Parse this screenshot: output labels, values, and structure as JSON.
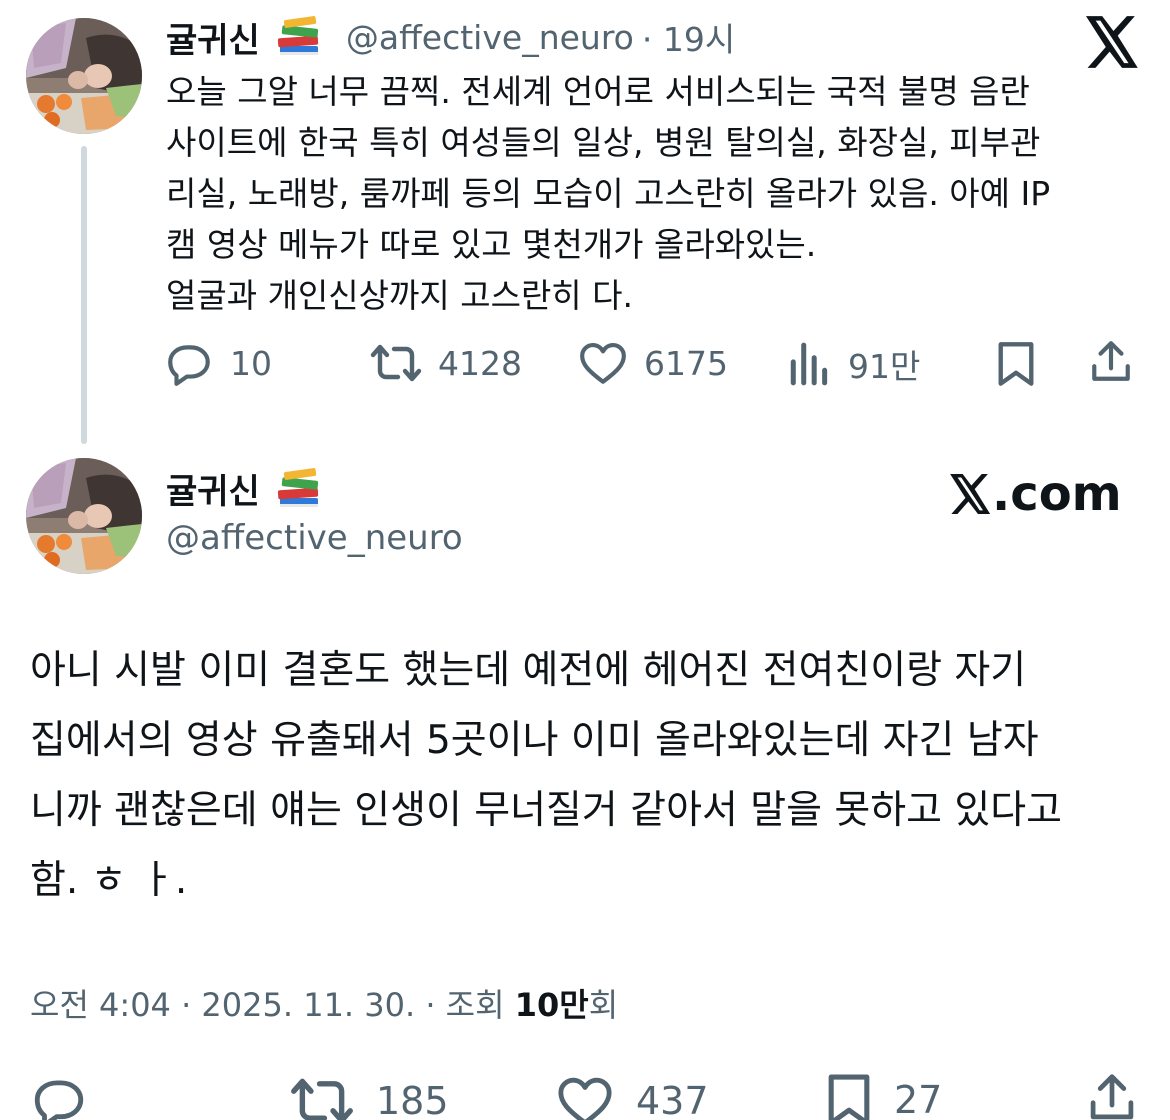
{
  "tweet1": {
    "display_name": "귤귀신",
    "handle": "@affective_neuro",
    "time": "· 19시",
    "body_lines": [
      "오늘 그알 너무 끔찍. 전세계 언어로 서비스되는 국적 불명 음란",
      "사이트에 한국 특히 여성들의 일상, 병원 탈의실, 화장실, 피부관",
      "리실, 노래방, 룸까페 등의 모습이 고스란히 올라가 있음. 아예 IP",
      "캠 영상 메뉴가 따로 있고 몇천개가 올라와있는.",
      "얼굴과 개인신상까지 고스란히 다."
    ],
    "replies": "10",
    "reposts": "4128",
    "likes": "6175",
    "views": "91만"
  },
  "tweet2": {
    "display_name": "귤귀신",
    "handle": "@affective_neuro",
    "brand": ".com",
    "body_lines": [
      "아니 시발 이미 결혼도 했는데 예전에 헤어진 전여친이랑 자기",
      "집에서의 영상 유출돼서 5곳이나 이미 올라와있는데 자긴 남자",
      "니까 괜찮은데 얘는 인생이 무너질거 같아서 말을 못하고 있다고",
      "함. ㅎ ㅏ."
    ],
    "meta_prefix": "오전 4:04 · 2025. 11. 30. · 조회 ",
    "views_bold": "10만",
    "views_suffix": "회",
    "replies": "",
    "reposts": "185",
    "likes": "437",
    "bookmarks": "27"
  },
  "icons": {
    "emoji": "books-emoji",
    "reply": "reply-icon",
    "repost": "repost-icon",
    "like": "heart-icon",
    "views": "views-icon",
    "bookmark": "bookmark-icon",
    "share": "share-icon",
    "logo": "x-logo-icon"
  },
  "colors": {
    "text": "#0f1419",
    "secondary": "#536471",
    "thread_line": "#cfd9de"
  }
}
